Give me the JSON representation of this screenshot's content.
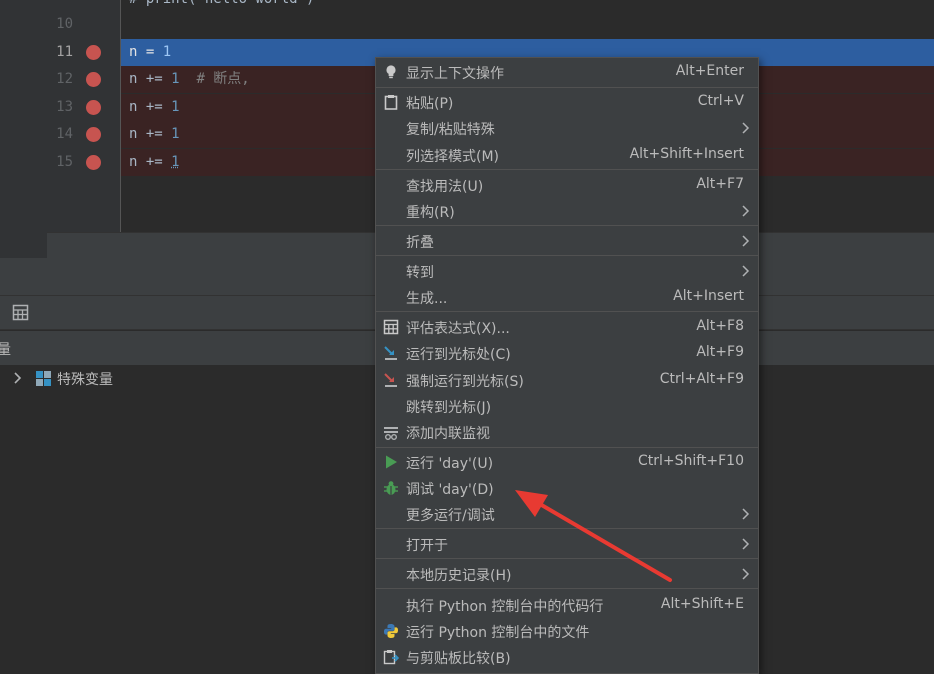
{
  "editor": {
    "top_fragment": "# print(\"hello world\")",
    "lines": [
      {
        "no": "10",
        "code": "",
        "breakpoint": false,
        "current": false
      },
      {
        "no": "11",
        "code": "n = 1",
        "breakpoint": true,
        "current": true
      },
      {
        "no": "12",
        "code": "n += 1  # 断点,",
        "breakpoint": true,
        "current": false
      },
      {
        "no": "13",
        "code": "n += 1",
        "breakpoint": true,
        "current": false
      },
      {
        "no": "14",
        "code": "n += 1",
        "breakpoint": true,
        "current": false
      },
      {
        "no": "15",
        "code": "n += 1",
        "breakpoint": true,
        "current": false
      }
    ],
    "code_parts": {
      "l11_var": "n = ",
      "l11_num": "1",
      "l12_var": "n += ",
      "l12_num": "1",
      "l12_comment": "  # 断点,",
      "l13_var": "n += ",
      "l13_num": "1",
      "l14_var": "n += ",
      "l14_num": "1",
      "l15_var": "n += ",
      "l15_num": "1"
    }
  },
  "debug_panel": {
    "header_label": "量",
    "tree_items": [
      {
        "label": "特殊变量"
      }
    ]
  },
  "context_menu": {
    "items": [
      {
        "label": "显示上下文操作",
        "shortcut": "Alt+Enter",
        "icon": "lightbulb-icon"
      },
      {
        "label": "粘贴(P)",
        "shortcut": "Ctrl+V",
        "icon": "clipboard-icon"
      },
      {
        "label": "复制/粘贴特殊",
        "shortcut": "",
        "icon": ""
      },
      {
        "label": "列选择模式(M)",
        "shortcut": "Alt+Shift+Insert",
        "icon": ""
      },
      {
        "label": "查找用法(U)",
        "shortcut": "Alt+F7",
        "icon": ""
      },
      {
        "label": "重构(R)",
        "shortcut": "",
        "icon": ""
      },
      {
        "label": "折叠",
        "shortcut": "",
        "icon": ""
      },
      {
        "label": "转到",
        "shortcut": "",
        "icon": ""
      },
      {
        "label": "生成...",
        "shortcut": "Alt+Insert",
        "icon": ""
      },
      {
        "label": "评估表达式(X)...",
        "shortcut": "Alt+F8",
        "icon": "calculator-icon"
      },
      {
        "label": "运行到光标处(C)",
        "shortcut": "Alt+F9",
        "icon": "run-to-cursor-icon"
      },
      {
        "label": "强制运行到光标(S)",
        "shortcut": "Ctrl+Alt+F9",
        "icon": "force-run-to-cursor-icon"
      },
      {
        "label": "跳转到光标(J)",
        "shortcut": "",
        "icon": ""
      },
      {
        "label": "添加内联监视",
        "shortcut": "",
        "icon": "watch-icon"
      },
      {
        "label": "运行 'day'(U)",
        "shortcut": "Ctrl+Shift+F10",
        "icon": "run-icon"
      },
      {
        "label": "调试 'day'(D)",
        "shortcut": "",
        "icon": "debug-bug-icon"
      },
      {
        "label": "更多运行/调试",
        "shortcut": "",
        "icon": ""
      },
      {
        "label": "打开于",
        "shortcut": "",
        "icon": ""
      },
      {
        "label": "本地历史记录(H)",
        "shortcut": "",
        "icon": ""
      },
      {
        "label": "执行 Python 控制台中的代码行",
        "shortcut": "Alt+Shift+E",
        "icon": ""
      },
      {
        "label": "运行 Python 控制台中的文件",
        "shortcut": "",
        "icon": "python-icon"
      },
      {
        "label": "与剪贴板比较(B)",
        "shortcut": "",
        "icon": "compare-clipboard-icon"
      }
    ]
  },
  "colors": {
    "current_line": "#2d5ea0",
    "breakpoint": "#c75450",
    "breakpoint_line": "#3a2323",
    "menu_bg": "#3c3f41",
    "arrow": "#e83a32"
  }
}
